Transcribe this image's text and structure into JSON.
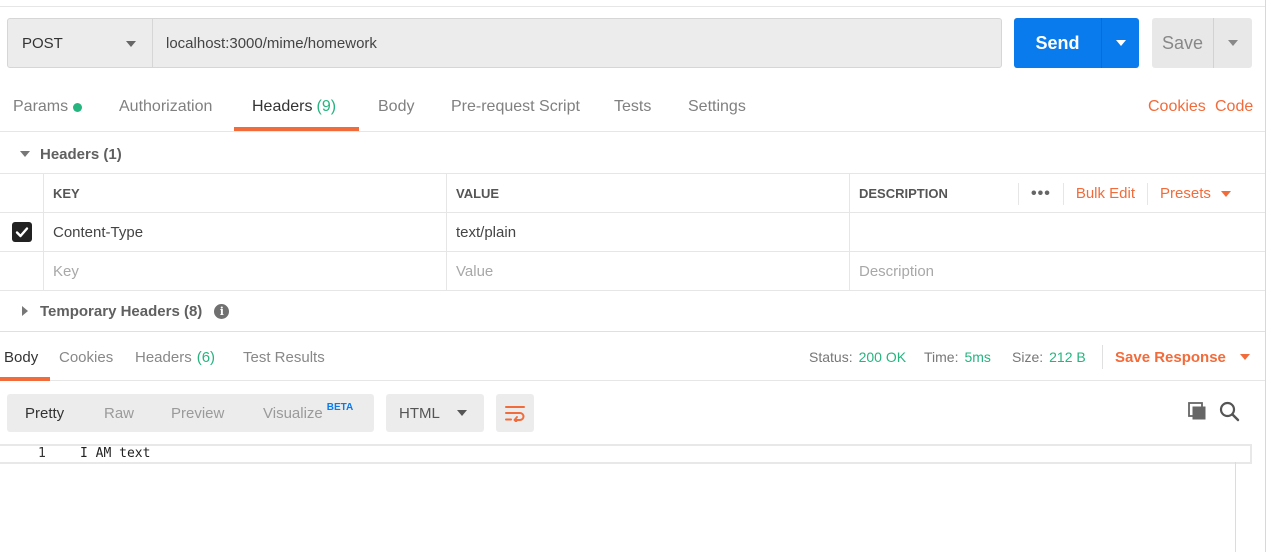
{
  "request": {
    "method": "POST",
    "url": "localhost:3000/mime/homework",
    "send_label": "Send",
    "save_label": "Save"
  },
  "request_tabs": {
    "params": "Params",
    "authorization": "Authorization",
    "headers": "Headers",
    "headers_count": "(9)",
    "body": "Body",
    "prerequest": "Pre-request Script",
    "tests": "Tests",
    "settings": "Settings",
    "cookies": "Cookies",
    "code": "Code"
  },
  "headers_section": {
    "title": "Headers (1)",
    "columns": {
      "key": "KEY",
      "value": "VALUE",
      "description": "DESCRIPTION"
    },
    "more_label": "•••",
    "bulk_edit": "Bulk Edit",
    "presets": "Presets",
    "rows": [
      {
        "checked": true,
        "key": "Content-Type",
        "value": "text/plain",
        "description": ""
      }
    ],
    "placeholder": {
      "key": "Key",
      "value": "Value",
      "description": "Description"
    },
    "temporary_title": "Temporary Headers (8)",
    "info_glyph": "i"
  },
  "response": {
    "tabs": {
      "body": "Body",
      "cookies": "Cookies",
      "headers": "Headers",
      "headers_count": "(6)",
      "test_results": "Test Results"
    },
    "status_label": "Status:",
    "status_value": "200 OK",
    "time_label": "Time:",
    "time_value": "5ms",
    "size_label": "Size:",
    "size_value": "212 B",
    "save_response": "Save Response",
    "views": {
      "pretty": "Pretty",
      "raw": "Raw",
      "preview": "Preview",
      "visualize": "Visualize",
      "beta": "BETA"
    },
    "format": "HTML",
    "lines": [
      {
        "num": "1",
        "text": "I AM text"
      }
    ]
  },
  "colors": {
    "accent_orange": "#f26b3a",
    "send_blue": "#097bed",
    "status_green": "#26b47f"
  },
  "icons": [
    "chevron-down-icon",
    "checkbox-checked-icon",
    "info-icon",
    "wrap-lines-icon",
    "copy-icon",
    "search-icon"
  ]
}
